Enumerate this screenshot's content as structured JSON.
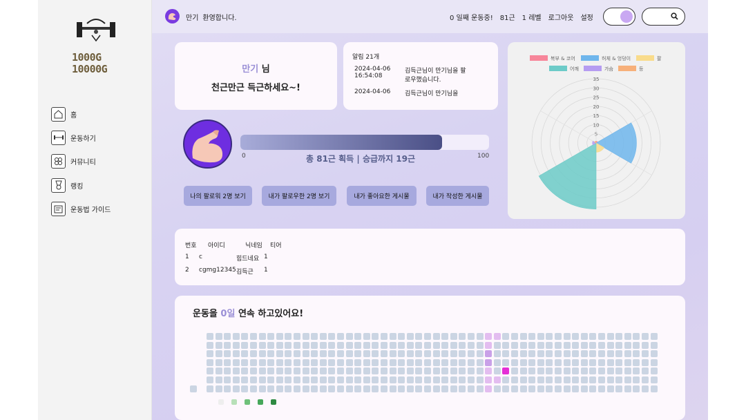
{
  "logo": {
    "line1": "1000G",
    "line2": "10000G"
  },
  "sidebar": {
    "items": [
      {
        "label": "홈",
        "icon": "home-icon"
      },
      {
        "label": "운동하기",
        "icon": "exercise-icon"
      },
      {
        "label": "커뮤니티",
        "icon": "community-icon"
      },
      {
        "label": "랭킹",
        "icon": "ranking-icon"
      },
      {
        "label": "운동법 가이드",
        "icon": "guide-icon"
      }
    ]
  },
  "header": {
    "name": "만기",
    "welcome": "환영합니다.",
    "links": [
      "0 일째 운동중!",
      "81근",
      "1 레벨",
      "로그아웃",
      "설정"
    ]
  },
  "greeting": {
    "name": "만기",
    "suffix": " 님",
    "message": "천근만근 득근하세요~!"
  },
  "alarm": {
    "title": "알림 21개",
    "items": [
      {
        "date": "2024-04-06 16:54:08",
        "text": "김득근님이 만기님을 팔로우했습니다."
      },
      {
        "date": "2024-04-06",
        "text": "김득근님이 만기님을"
      }
    ]
  },
  "progress": {
    "value": 81,
    "max": 100,
    "min_label": "0",
    "max_label": "100",
    "summary": "총 81근 획득 | 승급까지 19근"
  },
  "buttons": [
    "나의 팔로워 2명 보기",
    "내가 팔로우한 2명 보기",
    "내가 좋아요한 게시물",
    "내가 작성한 게시물"
  ],
  "follow_table": {
    "headers": [
      "번호",
      "아이디",
      "닉네임",
      "티어"
    ],
    "rows": [
      [
        "1",
        "c",
        "힘드네요",
        "1"
      ],
      [
        "2",
        "cgmg12345",
        "김득근",
        "1"
      ]
    ]
  },
  "streak": {
    "prefix": "운동을 ",
    "days": "0일",
    "suffix": " 연속 하고있어요!"
  },
  "colors": {
    "accent": "#9a8fd6",
    "button": "#a7a9de",
    "bar_dark": "#4a4f86",
    "cell": "#cbd5e3",
    "cell_light": "#e3bdf0",
    "cell_mid": "#c9a0e8",
    "cell_hot": "#e52fd6"
  },
  "chart_data": {
    "type": "radar",
    "categories": [
      "복부 & 코어",
      "허체 & 엉덩이",
      "팔",
      "어깨",
      "가슴",
      "등"
    ],
    "values": [
      1,
      22,
      5,
      36,
      2,
      1
    ],
    "colors": [
      "#f7869a",
      "#6fb6ec",
      "#f9dc8c",
      "#6ccbc8",
      "#b59cf1",
      "#f7b07a"
    ],
    "ticks": [
      5,
      10,
      15,
      20,
      25,
      30,
      35
    ],
    "rlim": [
      0,
      35
    ],
    "grid": true,
    "legend_position": "top"
  }
}
